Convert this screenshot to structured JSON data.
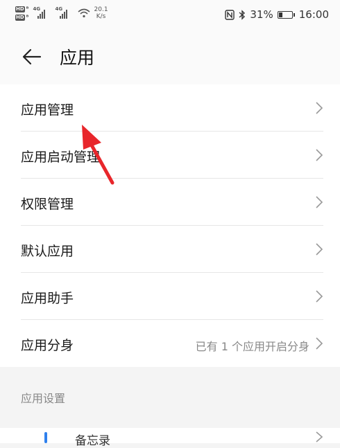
{
  "status_bar": {
    "hd_labels": [
      "HD",
      "HD"
    ],
    "network_1": "4G",
    "network_2": "4G",
    "speed_value": "20.1",
    "speed_unit": "K/s",
    "battery_percent": "31%",
    "battery_level": 0.31,
    "time": "16:00"
  },
  "header": {
    "title": "应用"
  },
  "menu": {
    "items": [
      {
        "label": "应用管理",
        "value": ""
      },
      {
        "label": "应用启动管理",
        "value": ""
      },
      {
        "label": "权限管理",
        "value": ""
      },
      {
        "label": "默认应用",
        "value": ""
      },
      {
        "label": "应用助手",
        "value": ""
      },
      {
        "label": "应用分身",
        "value": "已有 1 个应用开启分身"
      }
    ]
  },
  "settings_section": {
    "header": "应用设置",
    "peek_item_label": "备忘录"
  },
  "colors": {
    "annotation_arrow": "#e8262b",
    "accent": "#2f80ed"
  }
}
